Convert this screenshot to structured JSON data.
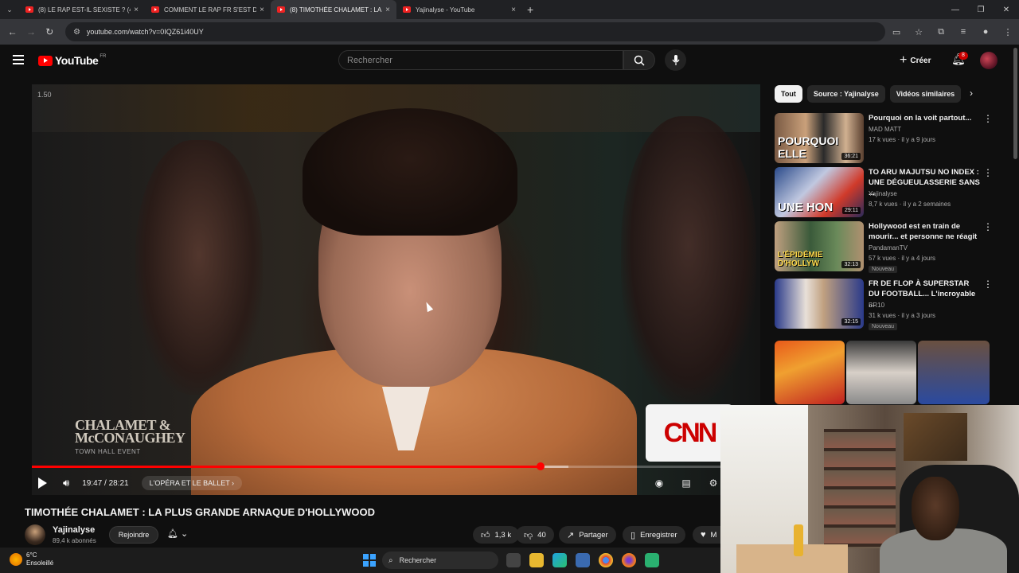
{
  "browser": {
    "tabs": [
      {
        "title": "(8) LE RAP EST-IL SEXISTE ? (4 F",
        "active": false
      },
      {
        "title": "COMMENT LE RAP FR S'EST DÉ",
        "active": false
      },
      {
        "title": "(8) TIMOTHÉE CHALAMET : LA",
        "active": true
      },
      {
        "title": "Yajinalyse - YouTube",
        "active": false
      }
    ],
    "url": "youtube.com/watch?v=0IQZ61i40UY",
    "new_tab_glyph": "+",
    "close_glyph": "×"
  },
  "yt_header": {
    "wordmark": "YouTube",
    "region": "FR",
    "search_placeholder": "Rechercher",
    "create_label": "Créer",
    "notification_count": "8"
  },
  "player": {
    "speed_label": "1.50",
    "watermark_line1": "CHALAMET &",
    "watermark_line2": "McCONAUGHEY",
    "watermark_sub": "TOWN HALL EVENT",
    "cnn_logo": "CNN",
    "time": "19:47 / 28:21",
    "chapter": "L'OPÉRA ET LE BALLET",
    "progress_fraction": 0.698,
    "buffered_fraction": 0.737
  },
  "video": {
    "title": "TIMOTHÉE CHALAMET : LA PLUS GRANDE ARNAQUE D'HOLLYWOOD",
    "channel_name": "Yajinalyse",
    "subscribers": "89,4 k abonnés",
    "join_label": "Rejoindre",
    "likes": "1,3 k",
    "dislikes": "40",
    "share_label": "Partager",
    "save_label": "Enregistrer",
    "more_label": "M"
  },
  "sidebar": {
    "chips": [
      "Tout",
      "Source : Yajinalyse",
      "Vidéos similaires"
    ],
    "recommendations": [
      {
        "title": "Pourquoi on la voit partout...",
        "channel": "MAD MATT",
        "meta": "17 k vues · il y a 9 jours",
        "duration": "36:21",
        "overlay": "POURQUOI ELLE",
        "badge": ""
      },
      {
        "title": "TO ARU MAJUTSU NO INDEX : UNE DÉGUEULASSERIE SANS ...",
        "channel": "Yajinalyse",
        "meta": "8,7 k vues · il y a 2 semaines",
        "duration": "29:11",
        "overlay": "UNE HON",
        "badge": ""
      },
      {
        "title": "Hollywood est en train de mourir... et personne ne réagit",
        "channel": "PandamanTV",
        "meta": "57 k vues · il y a 4 jours",
        "duration": "32:13",
        "overlay": "L'ÉPIDÉMIE D'HOLLYW",
        "badge": "Nouveau"
      },
      {
        "title": "FR DE FLOP À SUPERSTAR DU FOOTBALL... L'incroyable ...",
        "channel": "BR10",
        "meta": "31 k vues · il y a 3 jours",
        "duration": "32:15",
        "overlay": "",
        "badge": "Nouveau"
      }
    ]
  },
  "taskbar": {
    "temperature": "6°C",
    "condition": "Ensoleillé",
    "search_label": "Rechercher"
  },
  "colors": {
    "youtube_red": "#ff0000",
    "background": "#0f0f0f",
    "chip_active": "#f1f1f1"
  }
}
